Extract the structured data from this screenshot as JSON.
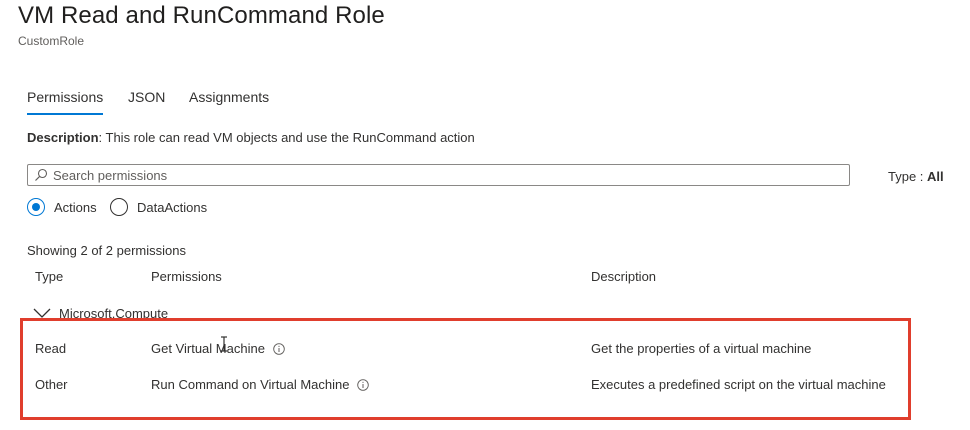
{
  "header": {
    "title": "VM Read and RunCommand Role",
    "subtitle": "CustomRole"
  },
  "tabs": [
    {
      "label": "Permissions",
      "active": true
    },
    {
      "label": "JSON",
      "active": false
    },
    {
      "label": "Assignments",
      "active": false
    }
  ],
  "description": {
    "label": "Description",
    "text": ": This role can read VM objects and use the RunCommand action"
  },
  "search": {
    "placeholder": "Search permissions",
    "value": ""
  },
  "type_filter": {
    "label": "Type : ",
    "value": "All"
  },
  "radio_options": [
    {
      "label": "Actions",
      "selected": true
    },
    {
      "label": "DataActions",
      "selected": false
    }
  ],
  "showing_text": "Showing 2 of 2 permissions",
  "table": {
    "columns": [
      "Type",
      "Permissions",
      "Description"
    ],
    "group": {
      "label": "Microsoft.Compute",
      "icon": "chevron-down-icon"
    },
    "rows": [
      {
        "type": "Read",
        "permission": "Get Virtual Machine",
        "description": "Get the properties of a virtual machine"
      },
      {
        "type": "Other",
        "permission": "Run Command on Virtual Machine",
        "description": "Executes a predefined script on the virtual machine"
      }
    ]
  },
  "colors": {
    "accent": "#0078d4",
    "highlight_border": "#e03e2d",
    "text": "#323130"
  }
}
